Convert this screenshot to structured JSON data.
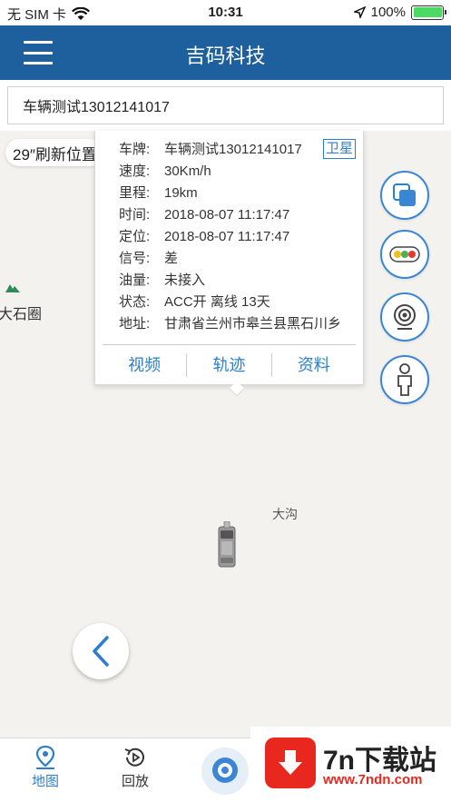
{
  "status_bar": {
    "carrier": "无 SIM 卡",
    "time": "10:31",
    "battery_percent": "100%",
    "battery_level": 1.0
  },
  "header": {
    "title": "吉码科技"
  },
  "search": {
    "value": "车辆测试13012141017"
  },
  "map": {
    "refresh_label": "29″刷新位置",
    "poi_label": "大石圈",
    "town_label": "大沟"
  },
  "popup": {
    "badge": "卫星",
    "rows": [
      {
        "key": "车牌:",
        "value": "车辆测试13012141017"
      },
      {
        "key": "速度:",
        "value": "30Km/h"
      },
      {
        "key": "里程:",
        "value": "19km"
      },
      {
        "key": "时间:",
        "value": "2018-08-07 11:17:47"
      },
      {
        "key": "定位:",
        "value": "2018-08-07 11:17:47"
      },
      {
        "key": "信号:",
        "value": "差"
      },
      {
        "key": "油量:",
        "value": "未接入"
      },
      {
        "key": "状态:",
        "value": "ACC开 离线 13天"
      },
      {
        "key": "地址:",
        "value": "甘肃省兰州市皋兰县黑石川乡"
      }
    ],
    "actions": [
      "视频",
      "轨迹",
      "资料"
    ]
  },
  "tabs": {
    "map_label": "地图",
    "playback_label": "回放"
  },
  "watermark": {
    "title": "7n下载站",
    "url": "www.7ndn.com"
  },
  "colors": {
    "nav": "#1e5f9e",
    "accent": "#2b7fd0",
    "map_bg": "#f4f2ee"
  }
}
